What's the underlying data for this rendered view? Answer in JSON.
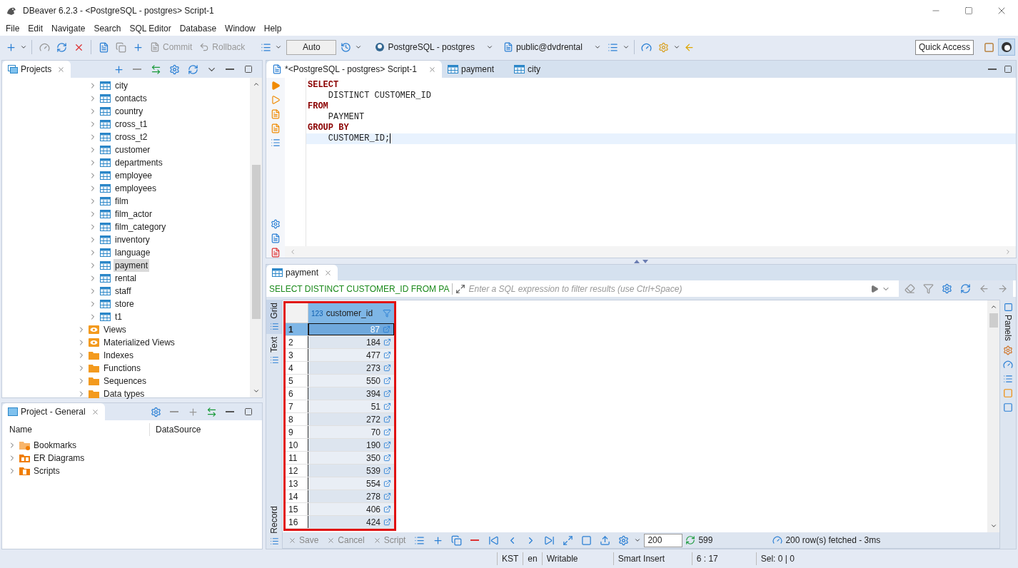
{
  "window": {
    "title": "DBeaver 6.2.3 - <PostgreSQL - postgres> Script-1"
  },
  "menu": [
    "File",
    "Edit",
    "Navigate",
    "Search",
    "SQL Editor",
    "Database",
    "Window",
    "Help"
  ],
  "toolbar": {
    "commit": {
      "label": "Commit",
      "disabled": true
    },
    "rollback": {
      "label": "Rollback",
      "disabled": true
    },
    "transaction_mode": "Auto",
    "connection": "PostgreSQL - postgres",
    "schema": "public@dvdrental",
    "quick_access": "Quick Access"
  },
  "projects_panel": {
    "title": "Projects",
    "tables": [
      {
        "label": "city",
        "selected": false
      },
      {
        "label": "contacts",
        "selected": false
      },
      {
        "label": "country",
        "selected": false
      },
      {
        "label": "cross_t1",
        "selected": false
      },
      {
        "label": "cross_t2",
        "selected": false
      },
      {
        "label": "customer",
        "selected": false
      },
      {
        "label": "departments",
        "selected": false
      },
      {
        "label": "employee",
        "selected": false
      },
      {
        "label": "employees",
        "selected": false
      },
      {
        "label": "film",
        "selected": false
      },
      {
        "label": "film_actor",
        "selected": false
      },
      {
        "label": "film_category",
        "selected": false
      },
      {
        "label": "inventory",
        "selected": false
      },
      {
        "label": "language",
        "selected": false
      },
      {
        "label": "payment",
        "selected": true
      },
      {
        "label": "rental",
        "selected": false
      },
      {
        "label": "staff",
        "selected": false
      },
      {
        "label": "store",
        "selected": false
      },
      {
        "label": "t1",
        "selected": false
      }
    ],
    "folders": [
      {
        "label": "Views",
        "kind": "view"
      },
      {
        "label": "Materialized Views",
        "kind": "view"
      },
      {
        "label": "Indexes",
        "kind": "folder"
      },
      {
        "label": "Functions",
        "kind": "folder"
      },
      {
        "label": "Sequences",
        "kind": "folder"
      },
      {
        "label": "Data types",
        "kind": "folder"
      }
    ]
  },
  "project_general": {
    "title": "Project - General",
    "columns": [
      "Name",
      "DataSource"
    ],
    "items": [
      {
        "label": "Bookmarks",
        "kind": "bookmarks"
      },
      {
        "label": "ER Diagrams",
        "kind": "diagrams"
      },
      {
        "label": "Scripts",
        "kind": "scripts"
      }
    ]
  },
  "editor": {
    "tabs": [
      {
        "label": "*<PostgreSQL - postgres> Script-1",
        "kind": "script",
        "selected": true
      },
      {
        "label": "payment",
        "kind": "table",
        "selected": false
      },
      {
        "label": "city",
        "kind": "table",
        "selected": false
      }
    ],
    "lines": [
      {
        "kind": "keyword",
        "text": "SELECT",
        "current": false
      },
      {
        "kind": "code",
        "text": "    DISTINCT CUSTOMER_ID",
        "current": false
      },
      {
        "kind": "keyword",
        "text": "FROM",
        "current": false
      },
      {
        "kind": "code",
        "text": "    PAYMENT",
        "current": false
      },
      {
        "kind": "keyword",
        "text": "GROUP BY",
        "current": false
      },
      {
        "kind": "code",
        "text": "    CUSTOMER_ID;",
        "current": true
      }
    ]
  },
  "results": {
    "tab": "payment",
    "query": "SELECT DISTINCT CUSTOMER_ID FROM PA",
    "filter_placeholder": "Enter a SQL expression to filter results (use Ctrl+Space)",
    "view_tabs": [
      {
        "label": "Grid",
        "selected": true
      },
      {
        "label": "Text",
        "selected": false
      },
      {
        "label": "Record",
        "selected": false
      }
    ],
    "panels_label": "Panels",
    "column": {
      "type": "123",
      "name": "customer_id"
    },
    "rows": [
      {
        "n": "1",
        "value": "87",
        "selected": true
      },
      {
        "n": "2",
        "value": "184",
        "selected": false
      },
      {
        "n": "3",
        "value": "477",
        "selected": false
      },
      {
        "n": "4",
        "value": "273",
        "selected": false
      },
      {
        "n": "5",
        "value": "550",
        "selected": false
      },
      {
        "n": "6",
        "value": "394",
        "selected": false
      },
      {
        "n": "7",
        "value": "51",
        "selected": false
      },
      {
        "n": "8",
        "value": "272",
        "selected": false
      },
      {
        "n": "9",
        "value": "70",
        "selected": false
      },
      {
        "n": "10",
        "value": "190",
        "selected": false
      },
      {
        "n": "11",
        "value": "350",
        "selected": false
      },
      {
        "n": "12",
        "value": "539",
        "selected": false
      },
      {
        "n": "13",
        "value": "554",
        "selected": false
      },
      {
        "n": "14",
        "value": "278",
        "selected": false
      },
      {
        "n": "15",
        "value": "406",
        "selected": false
      },
      {
        "n": "16",
        "value": "424",
        "selected": false
      }
    ],
    "actions": [
      {
        "label": "Save",
        "disabled": true
      },
      {
        "label": "Cancel",
        "disabled": true
      },
      {
        "label": "Script",
        "disabled": true
      }
    ],
    "fetch_size": "200",
    "total": "599",
    "summary": "200 row(s) fetched - 3ms"
  },
  "status_bar": [
    "KST",
    "en",
    "Writable",
    "Smart Insert",
    "6 : 17",
    "Sel: 0 | 0"
  ]
}
